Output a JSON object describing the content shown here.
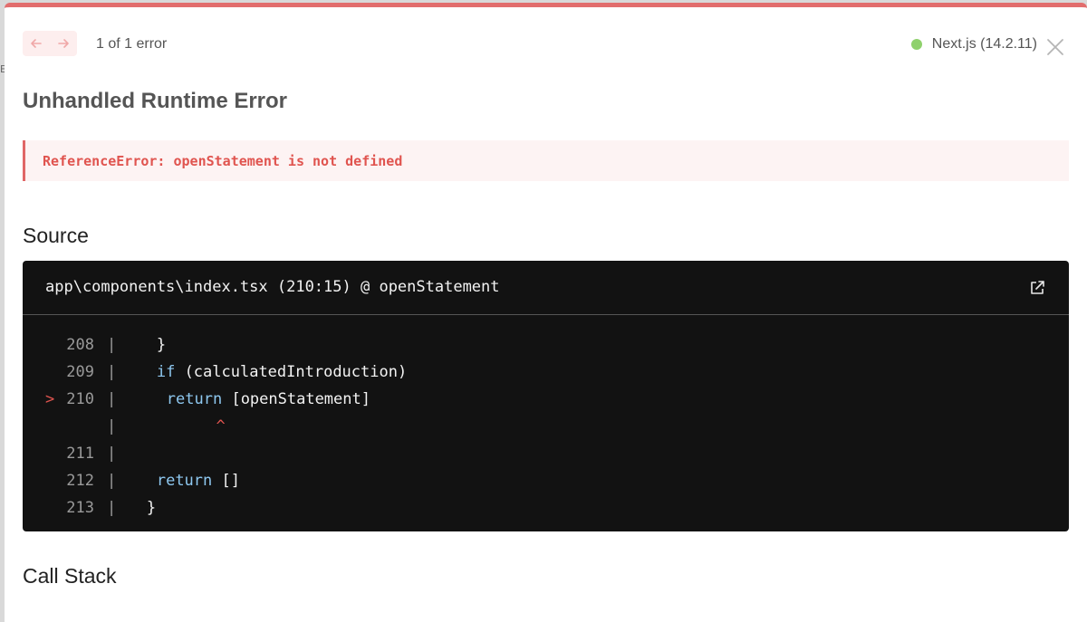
{
  "background": {
    "glyph": "E."
  },
  "header": {
    "prev_icon": "arrow-left-icon",
    "next_icon": "arrow-right-icon",
    "error_count": "1 of 1 error",
    "version_label": "Next.js (14.2.11)",
    "close_icon": "close-icon",
    "status_color": "#8fd16c"
  },
  "error": {
    "title": "Unhandled Runtime Error",
    "message": "ReferenceError: openStatement is not defined"
  },
  "source": {
    "section_title": "Source",
    "file_location": "app\\components\\index.tsx (210:15) @ openStatement",
    "open_icon": "external-link-icon",
    "lines": [
      {
        "marker": "",
        "number": "208",
        "gutter": "|",
        "keyword": "",
        "text": "}",
        "indent": 3
      },
      {
        "marker": "",
        "number": "209",
        "gutter": "|",
        "keyword": "if",
        "text": " (calculatedIntroduction)",
        "indent": 3
      },
      {
        "marker": ">",
        "number": "210",
        "gutter": "|",
        "keyword": "return",
        "text": " [openStatement]",
        "indent": 4
      },
      {
        "marker": "",
        "number": "",
        "gutter": "|",
        "keyword": "",
        "text": "^",
        "indent": 9
      },
      {
        "marker": "",
        "number": "211",
        "gutter": "|",
        "keyword": "",
        "text": "",
        "indent": 0
      },
      {
        "marker": "",
        "number": "212",
        "gutter": "|",
        "keyword": "return",
        "text": " []",
        "indent": 3
      },
      {
        "marker": "",
        "number": "213",
        "gutter": "|",
        "keyword": "",
        "text": "}",
        "indent": 2
      }
    ]
  },
  "callstack": {
    "section_title": "Call Stack"
  },
  "colors": {
    "accent": "#e26d6d",
    "error_text": "#e0544f",
    "code_bg": "#121212",
    "keyword": "#8ec8f0"
  }
}
